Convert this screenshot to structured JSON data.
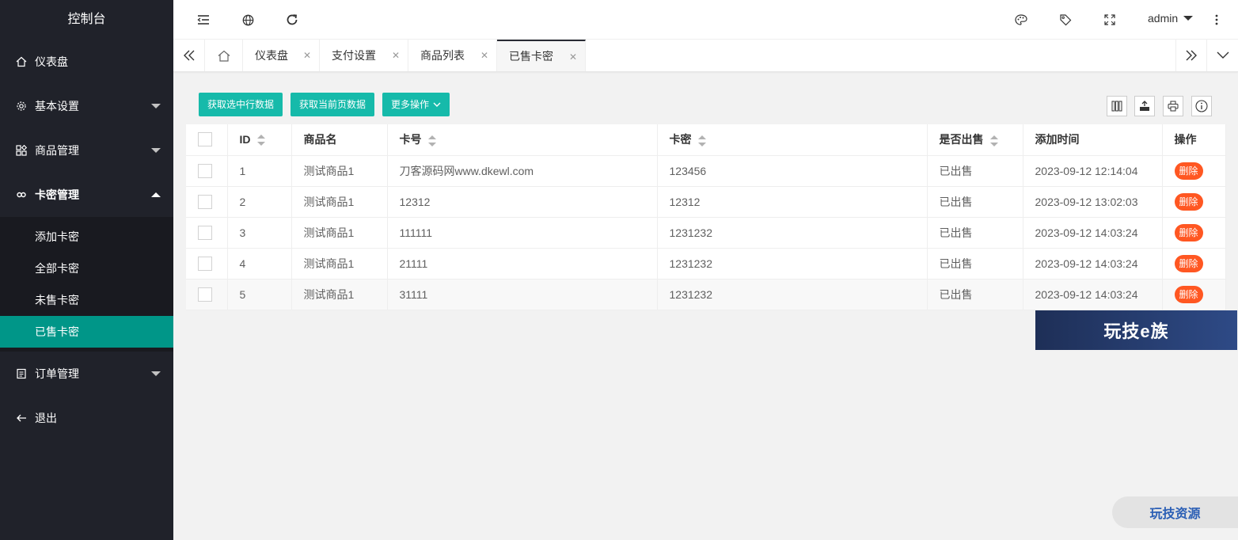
{
  "sidebar": {
    "title": "控制台",
    "items": [
      {
        "label": "仪表盘"
      },
      {
        "label": "基本设置"
      },
      {
        "label": "商品管理"
      },
      {
        "label": "卡密管理"
      },
      {
        "label": "订单管理"
      },
      {
        "label": "退出"
      }
    ],
    "sub_items": [
      {
        "label": "添加卡密"
      },
      {
        "label": "全部卡密"
      },
      {
        "label": "未售卡密"
      },
      {
        "label": "已售卡密"
      }
    ]
  },
  "header": {
    "user": "admin",
    "icons": [
      "menu-fold-icon",
      "globe-icon",
      "refresh-icon",
      "palette-icon",
      "tag-icon",
      "fullscreen-icon",
      "more-vertical-icon"
    ]
  },
  "tabs": [
    {
      "label": "仪表盘"
    },
    {
      "label": "支付设置"
    },
    {
      "label": "商品列表"
    },
    {
      "label": "已售卡密"
    }
  ],
  "toolbar": {
    "btn_selected": "获取选中行数据",
    "btn_page": "获取当前页数据",
    "btn_more": "更多操作"
  },
  "table": {
    "headers": [
      "ID",
      "商品名",
      "卡号",
      "卡密",
      "是否出售",
      "添加时间",
      "操作"
    ],
    "rows": [
      {
        "id": "1",
        "name": "测试商品1",
        "card": "刀客源码网www.dkewl.com",
        "secret": "123456",
        "sold": "已出售",
        "time": "2023-09-12 12:14:04",
        "action": "删除"
      },
      {
        "id": "2",
        "name": "测试商品1",
        "card": "12312",
        "secret": "12312",
        "sold": "已出售",
        "time": "2023-09-12 13:02:03",
        "action": "删除"
      },
      {
        "id": "3",
        "name": "测试商品1",
        "card": "111111",
        "secret": "1231232",
        "sold": "已出售",
        "time": "2023-09-12 14:03:24",
        "action": "删除"
      },
      {
        "id": "4",
        "name": "测试商品1",
        "card": "21111",
        "secret": "1231232",
        "sold": "已出售",
        "time": "2023-09-12 14:03:24",
        "action": "删除"
      },
      {
        "id": "5",
        "name": "测试商品1",
        "card": "31111",
        "secret": "1231232",
        "sold": "已出售",
        "time": "2023-09-12 14:03:24",
        "action": "删除"
      }
    ]
  },
  "watermarks": {
    "banner": "玩技e族",
    "badge": "玩技资源"
  },
  "colors": {
    "sidebar_bg": "#20222a",
    "active": "#009688",
    "button": "#16baaa",
    "danger": "#ff5722"
  }
}
